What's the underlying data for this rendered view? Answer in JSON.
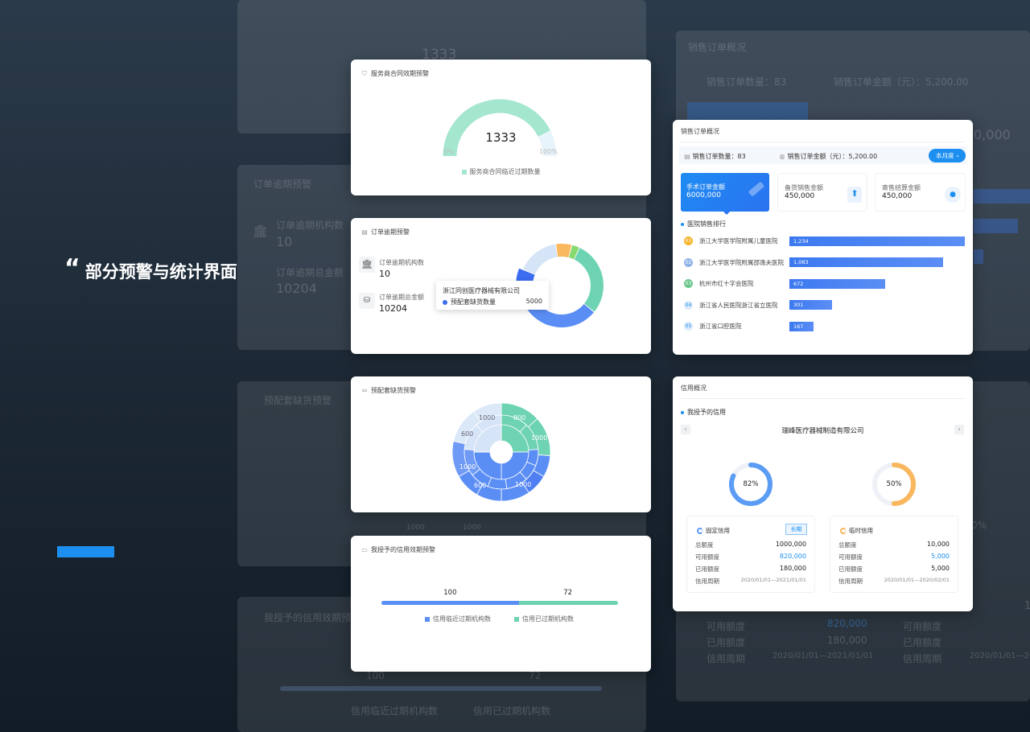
{
  "headline": "部分预警与统计界面",
  "headline_quote": "“",
  "ghost": {
    "value_1333": "1333",
    "order_title": "订单逾期预警",
    "org_count_label": "订单逾期机构数",
    "org_count": "10",
    "total_label": "订单逾期总金额",
    "total": "10204",
    "stock_title": "预配套缺货预警",
    "credit_title": "我授予的信用效期预警",
    "v100": "100",
    "v72": "72",
    "legend1": "信用临近过期机构数",
    "legend2": "信用已过期机构数",
    "sales_title": "销售订单概况",
    "sales_count": "销售订单数量：83",
    "sales_amount": "销售订单金额（元）：5,200.00",
    "avail": "可用额度",
    "avail_val": "820,000",
    "used": "已用额度",
    "used_val": "180,000",
    "period": "信用周期",
    "period_val": "2020/01/01—2021/01/01",
    "avail2": "可用额度",
    "used2": "已用额度",
    "period2": "信用周期",
    "period_val2": "2020/01/01—2020/0",
    "pct": "0%",
    "partial_amount": "0,000",
    "partial_one": "1",
    "d1000a": "1000",
    "d1000b": "1000"
  },
  "card_contract": {
    "title": "服务商合同效期预警",
    "value": "1333",
    "min": "0%",
    "max": "100%",
    "legend": "服务商合同临近过期数量",
    "fraction": 0.85,
    "colors": {
      "fill": "#a5e6cf",
      "rest": "#e8f4fb",
      "legend": "#a5e6cf"
    }
  },
  "card_overdue": {
    "title": "订单逾期预警",
    "org_label": "订单逾期机构数",
    "org_value": "10",
    "amount_label": "订单逾期总金额",
    "amount_value": "10204",
    "tooltip_title": "浙江同创医疗器械有限公司",
    "tooltip_label": "预配套缺货数量",
    "tooltip_value": "5000",
    "donut": [
      {
        "value": 28,
        "color": "#6dd3b2"
      },
      {
        "value": 30,
        "color": "#5b8ef5"
      },
      {
        "value": 14,
        "color": "#3c6cf0"
      },
      {
        "value": 16,
        "color": "#d6e4f7"
      },
      {
        "value": 6,
        "color": "#f9b75e"
      },
      {
        "value": 3,
        "color": "#86d96c"
      }
    ]
  },
  "card_stock": {
    "title": "预配套缺货预警",
    "labels": [
      "1000",
      "800",
      "1000",
      "600",
      "1000",
      "600",
      "1000"
    ]
  },
  "card_credit_expiry": {
    "title": "我授予的信用效期预警",
    "value1": "100",
    "value2": "72",
    "legend1": "信用临近过期机构数",
    "legend2": "信用已过期机构数",
    "fraction1": 0.58,
    "colors": {
      "c1": "#5b8ef5",
      "c2": "#6dd3b2"
    }
  },
  "card_sales": {
    "title": "销售订单概况",
    "count_label": "销售订单数量：",
    "count": "83",
    "amount_label": "销售订单金额（元）：",
    "amount": "5,200.00",
    "period_select": "本月度",
    "stats": [
      {
        "label": "手术订单金额",
        "value": "6000,000"
      },
      {
        "label": "备货销售金额",
        "value": "450,000"
      },
      {
        "label": "寄售结算金额",
        "value": "450,000"
      }
    ],
    "ranking_title": "医院销售排行",
    "ranking": [
      {
        "rank": "01",
        "name": "浙江大学医学院附属儿童医院",
        "value": "1,234",
        "v": 1234,
        "color": "#f5b52b"
      },
      {
        "rank": "02",
        "name": "浙江大学医学院附属邵逸夫医院",
        "value": "1,083",
        "v": 1083,
        "color": "#8fb3e8"
      },
      {
        "rank": "03",
        "name": "杭州市红十字会医院",
        "value": "672",
        "v": 672,
        "color": "#6bc78a"
      },
      {
        "rank": "04",
        "name": "浙江省人民医院浙江省立医院",
        "value": "301",
        "v": 301,
        "color": "#dbe9fb"
      },
      {
        "rank": "05",
        "name": "浙江省口腔医院",
        "value": "167",
        "v": 167,
        "color": "#dbe9fb"
      }
    ]
  },
  "card_credit": {
    "title": "信用概况",
    "section": "我授予的信用",
    "company": "瑞峰医疗器械制造有限公司",
    "ring1": {
      "pct": "82%",
      "fraction": 0.82,
      "color": "#5b9cf5"
    },
    "ring2": {
      "pct": "50%",
      "fraction": 0.5,
      "color": "#f9b75e"
    },
    "fixed": {
      "title": "固定信用",
      "badge": "长期",
      "total_label": "总额度",
      "total": "1000,000",
      "avail_label": "可用额度",
      "avail": "820,000",
      "used_label": "已用额度",
      "used": "180,000",
      "period_label": "信用周期",
      "period": "2020/01/01—2021/01/01"
    },
    "temp": {
      "title": "临时信用",
      "total_label": "总额度",
      "total": "10,000",
      "avail_label": "可用额度",
      "avail": "5,000",
      "used_label": "已用额度",
      "used": "5,000",
      "period_label": "信用周期",
      "period": "2020/01/01—2020/02/01"
    }
  }
}
